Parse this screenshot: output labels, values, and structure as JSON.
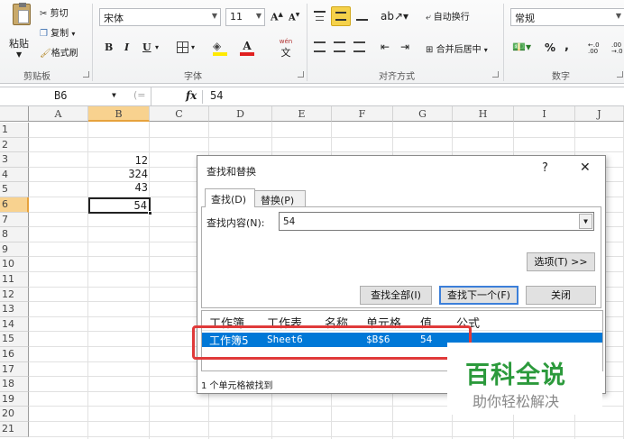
{
  "clipboard": {
    "paste": "粘贴",
    "cut": "剪切",
    "copy": "复制",
    "format_painter": "格式刷",
    "group_label": "剪贴板"
  },
  "font": {
    "name": "宋体",
    "size": "11",
    "bold": "B",
    "italic": "I",
    "underline": "U",
    "group_label": "字体",
    "phonetic": "wén"
  },
  "alignment": {
    "wrap": "自动换行",
    "merge": "合并后居中",
    "group_label": "对齐方式"
  },
  "number": {
    "format": "常规",
    "percent": "%",
    "comma": ",",
    "inc_decimal": "←.0 .00",
    "dec_decimal": ".00 →.0",
    "group_label": "数字"
  },
  "formula_bar": {
    "name_box": "B6",
    "fx": "fx",
    "value": "54"
  },
  "columns": [
    "A",
    "B",
    "C",
    "D",
    "E",
    "F",
    "G",
    "H",
    "I",
    "J"
  ],
  "rows": [
    "1",
    "2",
    "3",
    "4",
    "5",
    "6",
    "7",
    "8",
    "9",
    "10",
    "11",
    "12",
    "13",
    "14",
    "15",
    "16",
    "17",
    "18",
    "19",
    "20",
    "21"
  ],
  "cells": {
    "B3": "12",
    "B4": "324",
    "B5": "43",
    "B6": "54"
  },
  "dialog": {
    "title": "查找和替换",
    "help": "?",
    "close": "✕",
    "tab_find": "查找(D)",
    "tab_replace": "替换(P)",
    "find_label": "查找内容(N):",
    "find_value": "54",
    "options_button": "选项(T) >>",
    "find_all_button": "查找全部(I)",
    "find_next_button": "查找下一个(F)",
    "close_button": "关闭",
    "result_headers": [
      "工作簿",
      "工作表",
      "名称",
      "单元格",
      "值",
      "公式"
    ],
    "result_row": {
      "workbook": "工作簿5",
      "sheet": "Sheet6",
      "name": "",
      "cell": "$B$6",
      "value": "54",
      "formula": ""
    },
    "status": "1 个单元格被找到"
  },
  "watermark": {
    "title": "百科全说",
    "subtitle": "助你轻松解决"
  },
  "colors": {
    "selected_header": "#f8d28f",
    "result_highlight": "#0078d7",
    "annotation_red": "#e03a3a",
    "active_tab_yellow": "#f5d14a"
  }
}
